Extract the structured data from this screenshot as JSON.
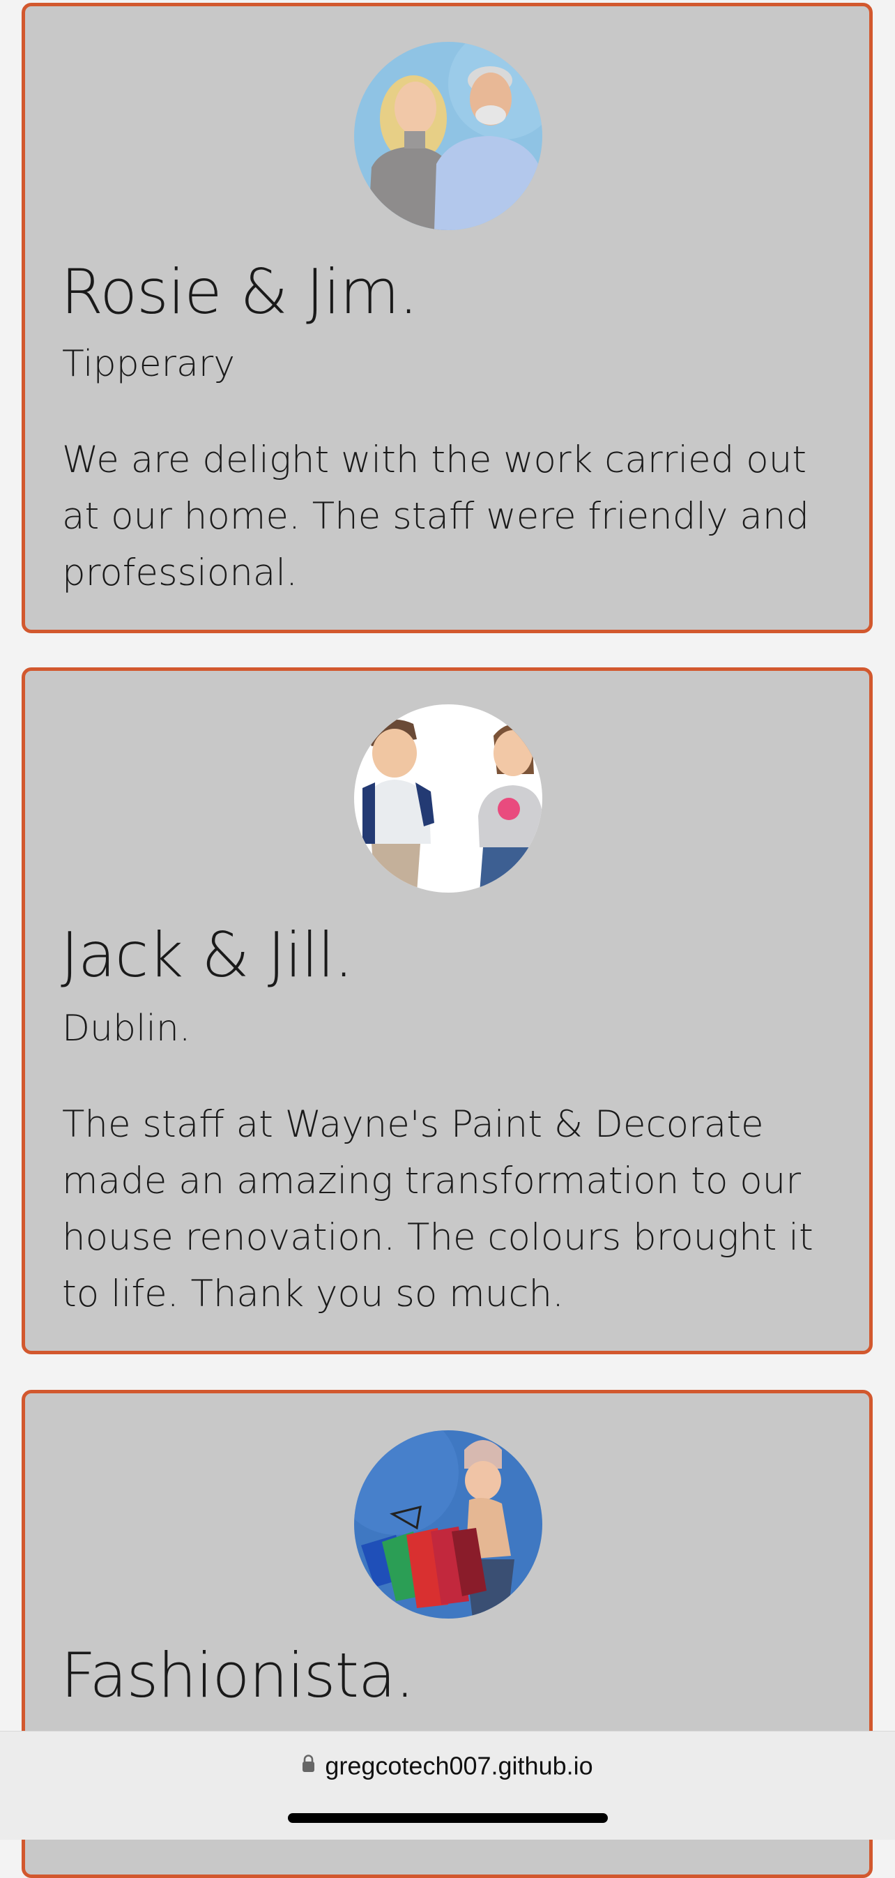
{
  "testimonials": [
    {
      "name": "Rosie & Jim.",
      "location": "Tipperary",
      "quote": "We are delight with the work carried out at our home. The staff were friendly and professional.",
      "avatar_icon": "couple-photo-icon"
    },
    {
      "name": "Jack & Jill.",
      "location": "Dublin.",
      "quote": "The staff at Wayne's Paint & Decorate made an amazing transformation to our house renovation. The colours brought it to life. Thank you so much.",
      "avatar_icon": "cartoon-couple-icon"
    },
    {
      "name": "Fashionista.",
      "location": "",
      "quote": "",
      "avatar_icon": "shopping-woman-photo-icon"
    }
  ],
  "browser": {
    "url": "gregcotech007.github.io",
    "lock_icon": "lock-icon"
  },
  "colors": {
    "card_border": "#d2582e",
    "card_background": "#c8c8c8",
    "page_background": "#f3f3f3"
  }
}
